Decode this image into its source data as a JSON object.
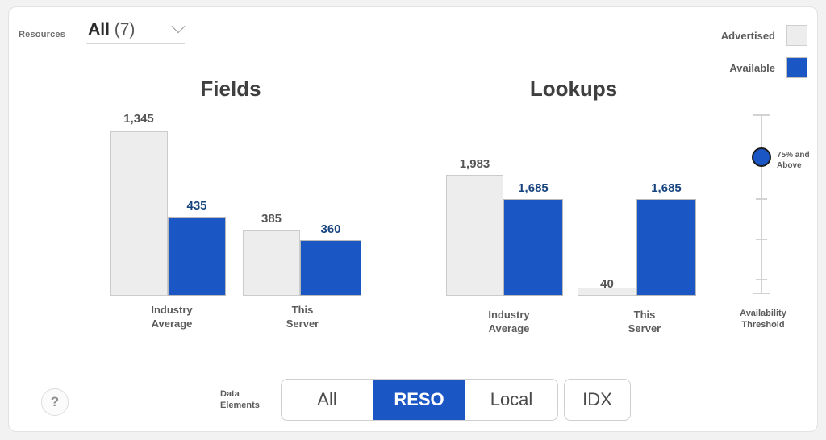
{
  "resources": {
    "label": "Resources",
    "value": "All",
    "count": "(7)",
    "chevron_icon": "chevron-down-icon"
  },
  "legend": {
    "advertised_label": "Advertised",
    "available_label": "Available",
    "advertised_color": "#ededed",
    "available_color": "#1a56c4"
  },
  "slider": {
    "knob_label_line1": "75% and",
    "knob_label_line2": "Above",
    "caption_line1": "Availability",
    "caption_line2": "Threshold",
    "value": "75% and Above"
  },
  "bottom": {
    "help_label": "?",
    "data_elements_line1": "Data",
    "data_elements_line2": "Elements",
    "segments": [
      {
        "label": "All",
        "active": false
      },
      {
        "label": "RESO",
        "active": true
      },
      {
        "label": "Local",
        "active": false
      }
    ],
    "idx_label": "IDX"
  },
  "chart_data": [
    {
      "type": "bar",
      "title": "Fields",
      "categories": [
        "Industry Average",
        "This Server"
      ],
      "category_labels": [
        {
          "line1": "Industry",
          "line2": "Average"
        },
        {
          "line1": "This",
          "line2": "Server"
        }
      ],
      "series": [
        {
          "name": "Advertised",
          "color": "#ededed",
          "values": [
            1345,
            385
          ],
          "value_labels": [
            "1,345",
            "385"
          ]
        },
        {
          "name": "Available",
          "color": "#1a56c4",
          "values": [
            435,
            360
          ],
          "value_labels": [
            "435",
            "360"
          ]
        }
      ],
      "xlabel": "",
      "ylabel": "",
      "ylim": [
        0,
        1983
      ],
      "grid": false,
      "legend_position": "top-right"
    },
    {
      "type": "bar",
      "title": "Lookups",
      "categories": [
        "Industry Average",
        "This Server"
      ],
      "category_labels": [
        {
          "line1": "Industry",
          "line2": "Average"
        },
        {
          "line1": "This",
          "line2": "Server"
        }
      ],
      "series": [
        {
          "name": "Advertised",
          "color": "#ededed",
          "values": [
            1983,
            40
          ],
          "value_labels": [
            "1,983",
            "40"
          ]
        },
        {
          "name": "Available",
          "color": "#1a56c4",
          "values": [
            1685,
            1685
          ],
          "value_labels": [
            "1,685",
            "1,685"
          ]
        }
      ],
      "xlabel": "",
      "ylabel": "",
      "ylim": [
        0,
        1983
      ],
      "grid": false,
      "legend_position": "top-right"
    }
  ]
}
